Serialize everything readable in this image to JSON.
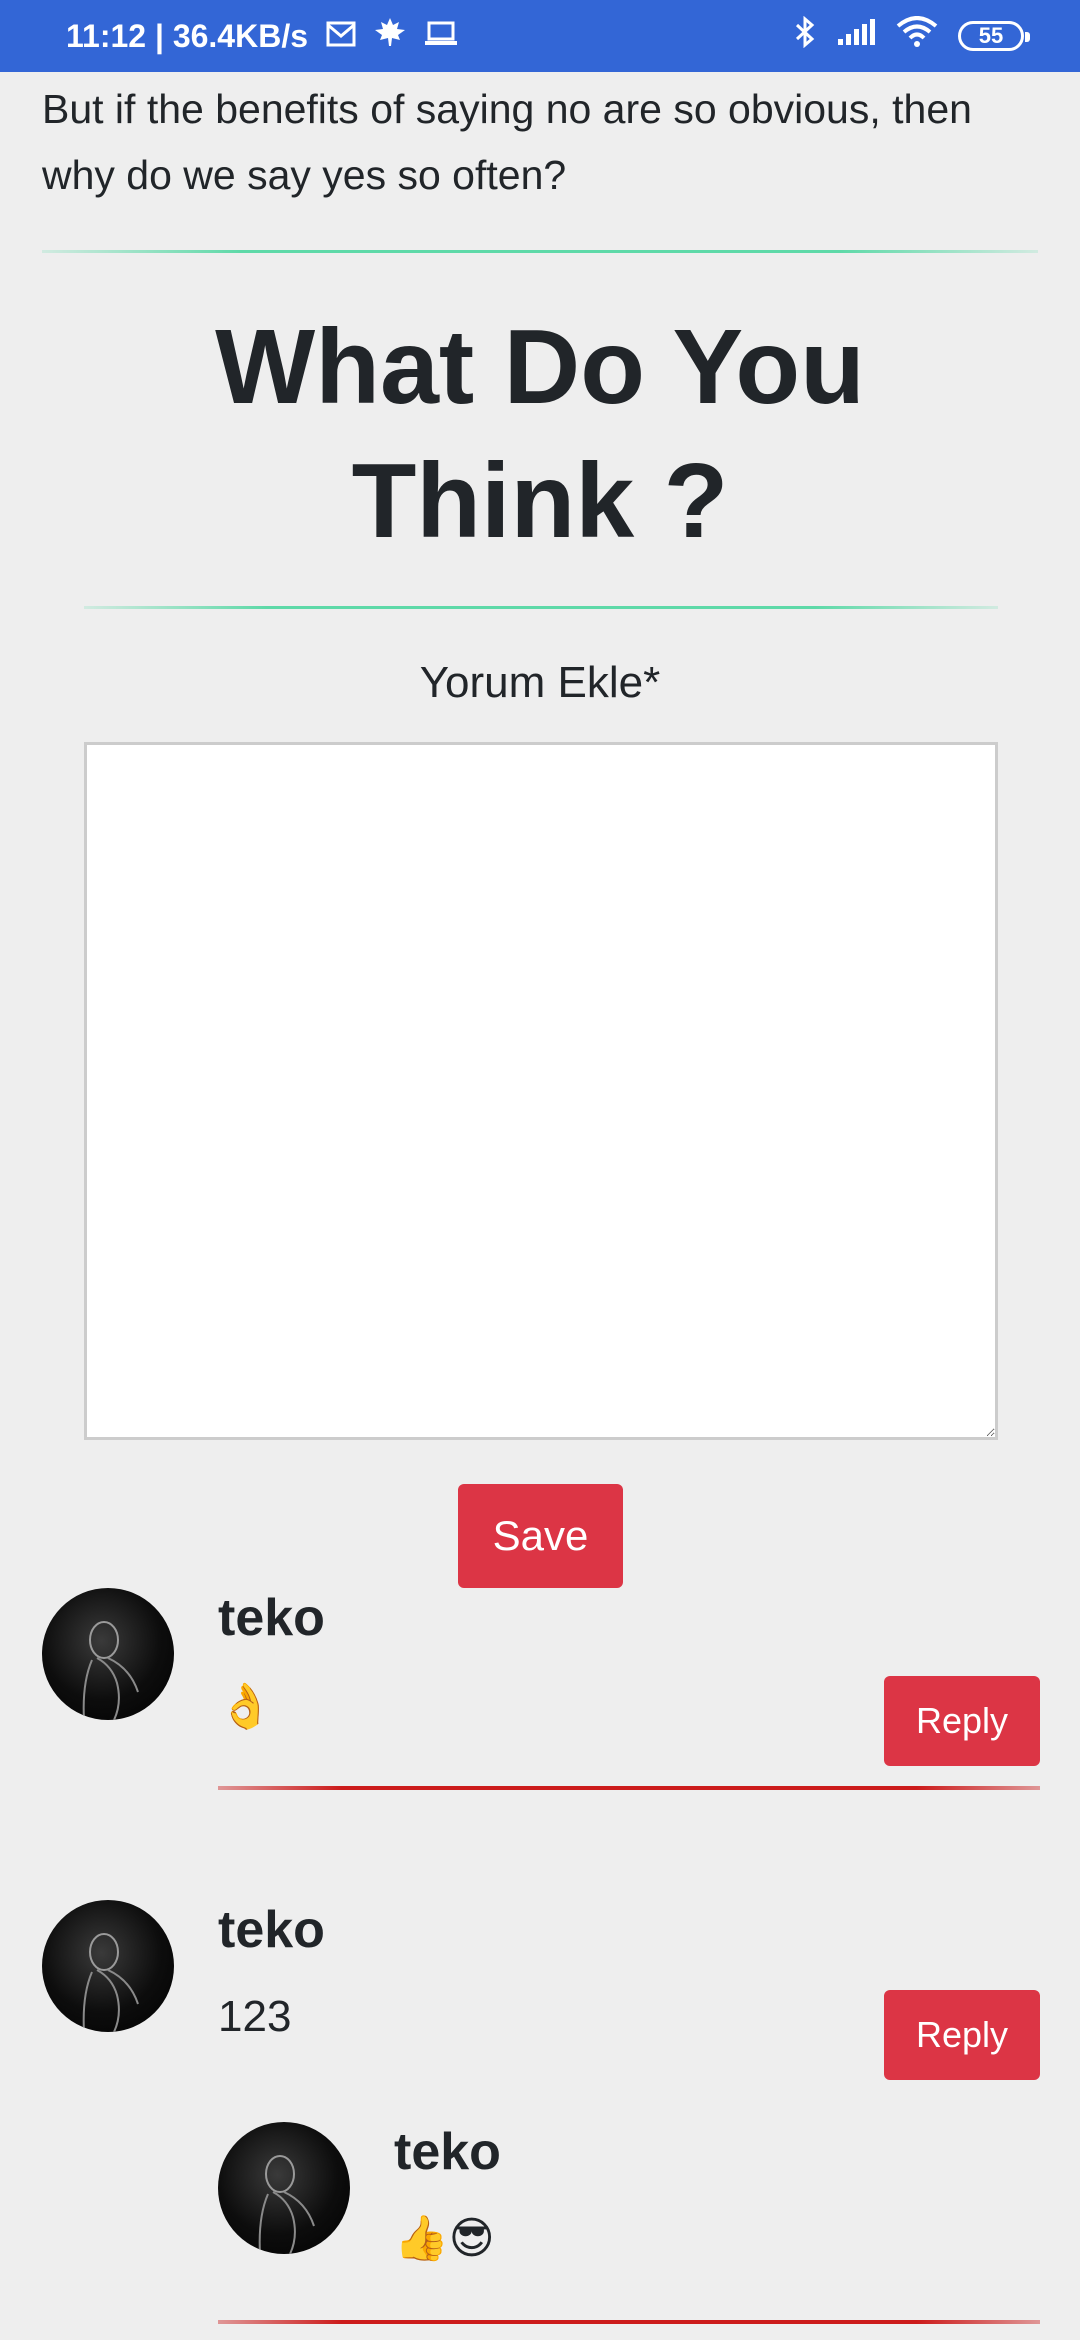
{
  "status_bar": {
    "time_speed": "11:12 | 36.4KB/s",
    "battery": "55",
    "icons": [
      "mail-icon",
      "leaf-icon",
      "laptop-icon",
      "bluetooth-icon",
      "signal-icon",
      "wifi-icon",
      "battery-icon"
    ]
  },
  "article": {
    "intro_text": "But if the benefits of saying no are so obvious, then why do we say yes so often?"
  },
  "comments_section": {
    "heading_line1": "What Do You",
    "heading_line2": "Think ?",
    "add_comment_label": "Yorum Ekle*",
    "comment_value": "",
    "save_label": "Save",
    "comments": [
      {
        "author": "teko",
        "text": "👌",
        "reply_label": "Reply"
      },
      {
        "author": "teko",
        "text": "123",
        "reply_label": "Reply",
        "replies": [
          {
            "author": "teko",
            "text": "👍😎"
          }
        ]
      }
    ]
  },
  "colors": {
    "status_bar": "#3366d6",
    "accent_button": "#dc3545",
    "divider_green": "#5ed9a8",
    "divider_red": "#cc1b1b",
    "background": "#eeeeee"
  }
}
